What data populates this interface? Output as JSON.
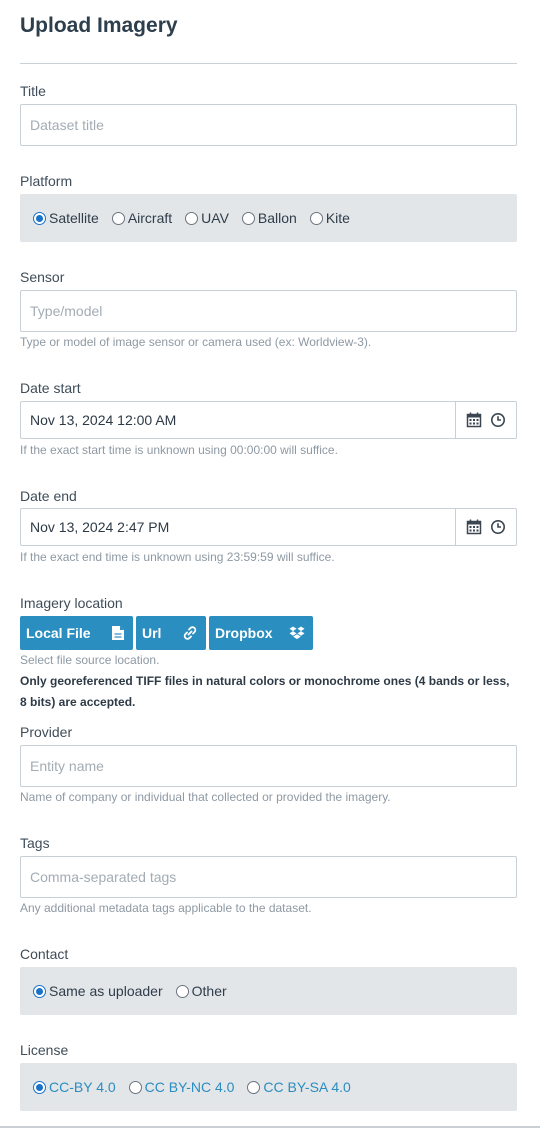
{
  "page": {
    "title": "Upload Imagery"
  },
  "title_field": {
    "label": "Title",
    "placeholder": "Dataset title"
  },
  "platform": {
    "label": "Platform",
    "options": [
      "Satellite",
      "Aircraft",
      "UAV",
      "Ballon",
      "Kite"
    ],
    "selected": "Satellite"
  },
  "sensor": {
    "label": "Sensor",
    "placeholder": "Type/model",
    "help": "Type or model of image sensor or camera used (ex: Worldview-3)."
  },
  "date_start": {
    "label": "Date start",
    "value": "Nov 13, 2024 12:00 AM",
    "help": "If the exact start time is unknown using 00:00:00 will suffice."
  },
  "date_end": {
    "label": "Date end",
    "value": "Nov 13, 2024 2:47 PM",
    "help": "If the exact end time is unknown using 23:59:59 will suffice."
  },
  "imagery_location": {
    "label": "Imagery location",
    "buttons": [
      {
        "label": "Local File",
        "icon": "file-icon"
      },
      {
        "label": "Url",
        "icon": "link-icon"
      },
      {
        "label": "Dropbox",
        "icon": "dropbox-icon"
      }
    ],
    "help": "Select file source location.",
    "note": "Only georeferenced TIFF files in natural colors or monochrome ones (4 bands or less, 8 bits) are accepted."
  },
  "provider": {
    "label": "Provider",
    "placeholder": "Entity name",
    "help": "Name of company or individual that collected or provided the imagery."
  },
  "tags": {
    "label": "Tags",
    "placeholder": "Comma-separated tags",
    "help": "Any additional metadata tags applicable to the dataset."
  },
  "contact": {
    "label": "Contact",
    "options": [
      "Same as uploader",
      "Other"
    ],
    "selected": "Same as uploader"
  },
  "license": {
    "label": "License",
    "options": [
      "CC-BY 4.0",
      "CC BY-NC 4.0",
      "CC BY-SA 4.0"
    ],
    "selected": "CC-BY 4.0"
  },
  "colors": {
    "accent": "#2a8ec0",
    "radio_box_bg": "#e3e6e9",
    "link": "#2a8dc0"
  }
}
